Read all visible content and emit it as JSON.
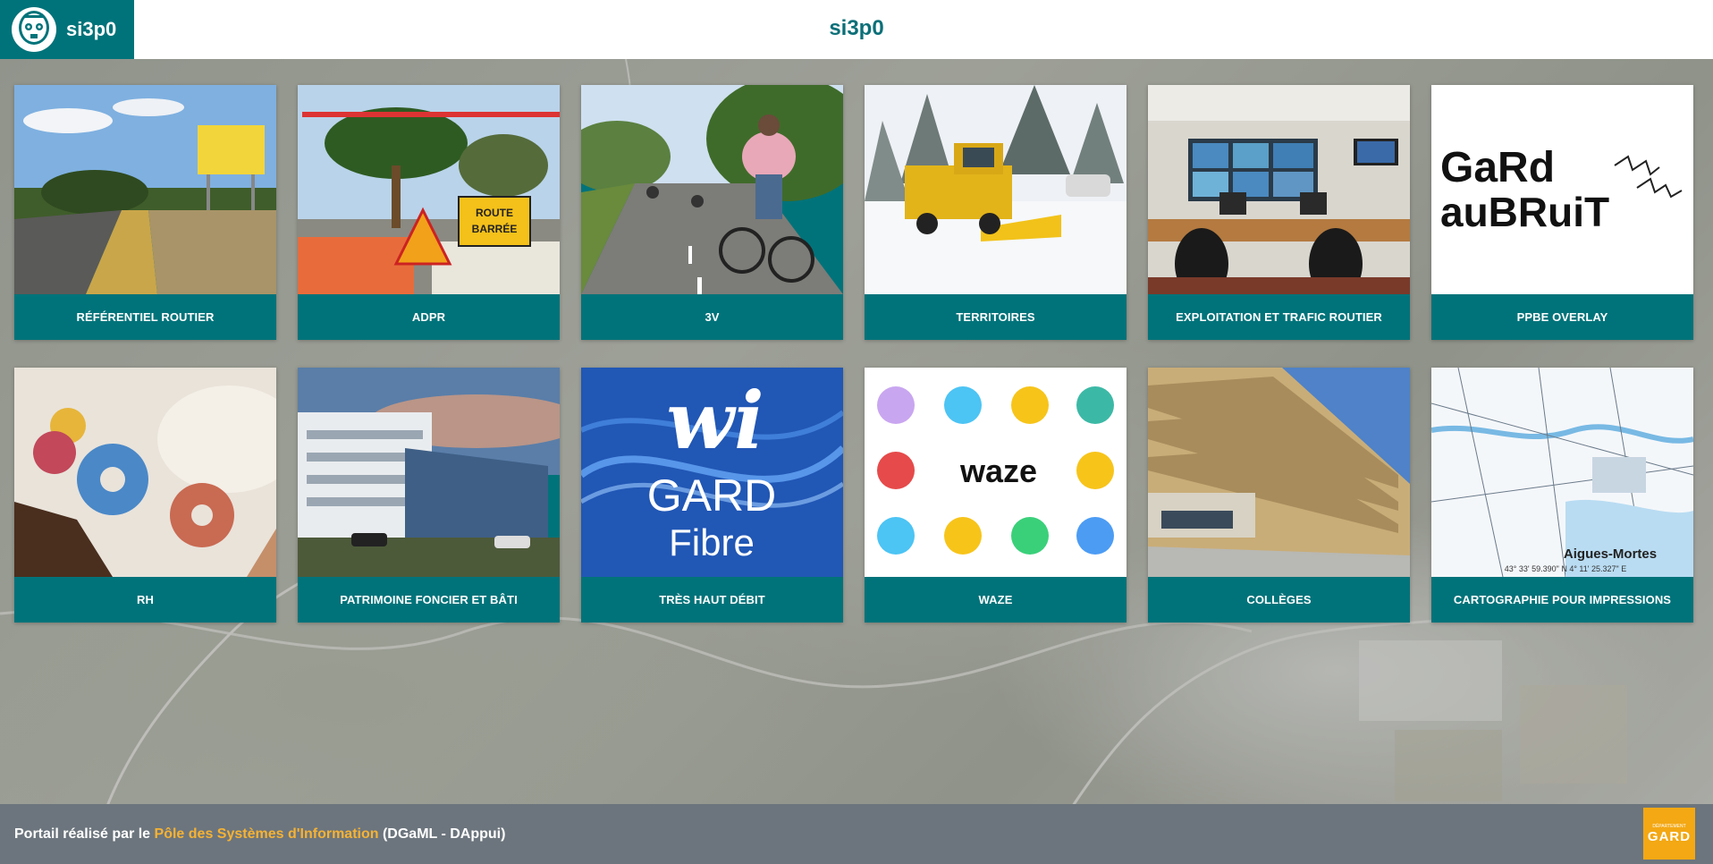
{
  "header": {
    "brand_name": "si3p0",
    "title": "si3p0"
  },
  "tiles": [
    {
      "label": "RÉFÉRENTIEL ROUTIER",
      "image": "road-photo"
    },
    {
      "label": "ADPR",
      "image": "road-closed-photo",
      "sign_lines": [
        "ROUTE",
        "BARRÉE"
      ]
    },
    {
      "label": "3V",
      "image": "cyclists-photo"
    },
    {
      "label": "TERRITOIRES",
      "image": "snowplow-photo"
    },
    {
      "label": "EXPLOITATION ET TRAFIC ROUTIER",
      "image": "control-room-photo"
    },
    {
      "label": "PPBE OVERLAY",
      "image": "gard-au-bruit-logo",
      "logo_line1": "GaRd",
      "logo_line2": "auBRuiT"
    },
    {
      "label": "RH",
      "image": "gears-photo"
    },
    {
      "label": "PATRIMOINE FONCIER ET BÂTI",
      "image": "building-photo"
    },
    {
      "label": "TRÈS HAUT DÉBIT",
      "image": "wi-gard-fibre-logo",
      "logo_line1": "wi",
      "logo_line2": "GARD",
      "logo_line3": "Fibre"
    },
    {
      "label": "WAZE",
      "image": "waze-logo",
      "logo_text": "waze"
    },
    {
      "label": "COLLÈGES",
      "image": "college-photo"
    },
    {
      "label": "CARTOGRAPHIE POUR IMPRESSIONS",
      "image": "map-print",
      "map_title": "Aigues-Mortes",
      "map_coords": "43° 33' 59.390\" N 4° 11' 25.327\" E"
    }
  ],
  "footer": {
    "prefix": "Portail réalisé par le ",
    "link": "Pôle des Systèmes d'Information",
    "suffix": " (DGaML - DAppui)",
    "logo_small": "DÉPARTEMENT",
    "logo_text": "GARD"
  },
  "colors": {
    "teal": "#00737a",
    "footer_bg": "#6c757d",
    "footer_link": "#f6b233"
  }
}
